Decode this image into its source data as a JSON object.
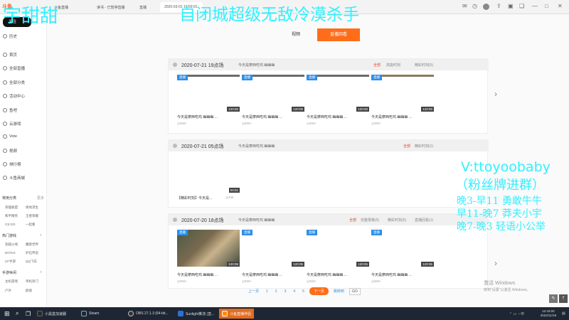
{
  "browser": {
    "logo": "斗鱼",
    "tabs": [
      "斗鱼直播",
      "读书 - 已暂停直播",
      "直播",
      "2020-03-01 19:59:01",
      "",
      "",
      ""
    ],
    "live_badge": "2 正在直播"
  },
  "overlay": {
    "name": "宇甜甜",
    "title": "自闭城超级无敌冷漠杀手",
    "contact": "V:ttoyoobaby",
    "fan": "（粉丝牌进群）",
    "schedule": [
      "晚3-早11 勇敢牛牛",
      "早11-晚7 莽夫小宇",
      "晚7-晚3  轻语小公举"
    ]
  },
  "sidebar": {
    "top": [
      {
        "icon": "heart-icon",
        "label": "关注"
      },
      {
        "icon": "history-icon",
        "label": "历史"
      }
    ],
    "nav": [
      {
        "icon": "home-icon",
        "label": "首页"
      },
      {
        "icon": "grid-icon",
        "label": "全部直播"
      },
      {
        "icon": "category-icon",
        "label": "全部分类"
      },
      {
        "icon": "activity-icon",
        "label": "活动中心"
      },
      {
        "icon": "video-icon",
        "label": "鱼吧"
      },
      {
        "icon": "game-icon",
        "label": "云游戏"
      },
      {
        "icon": "music-icon",
        "label": "Vote"
      },
      {
        "icon": "clip-icon",
        "label": "视频"
      },
      {
        "icon": "rank-icon",
        "label": "排行榜"
      },
      {
        "icon": "shop-icon",
        "label": "斗鱼商城"
      }
    ],
    "section1": {
      "title": "常用分类",
      "more": "更多"
    },
    "section1_items": [
      "英雄联盟",
      "绝地求生",
      "和平精英",
      "王者荣耀",
      "CS:GO",
      "一起看"
    ],
    "section2": {
      "title": "热门游戏",
      "more": "+"
    },
    "section2_items": [
      "穿越火线",
      "魔兽世界",
      "DOTA2",
      "炉石传说",
      "CF手游",
      "QQ飞车"
    ],
    "section3": {
      "title": "手游休闲",
      "more": "+"
    },
    "section3_items": [
      "主机游戏",
      "单机热门",
      "户外",
      "颜值"
    ]
  },
  "main": {
    "segments": [
      "视频",
      "直播回看"
    ],
    "pager": {
      "prev": "上一页",
      "pages": [
        "1",
        "2",
        "3",
        "4",
        "5"
      ],
      "current": "下一页",
      "jump": "跳转到",
      "go": "GO"
    },
    "cards": [
      {
        "date": "2020-07-21 19点场",
        "title": "今天是摩西吃鸡 幽幽幽",
        "filters": [
          "全部",
          "高能时刻",
          "精彩时刻(5)"
        ],
        "videos": [
          {
            "badge": "直播",
            "dur": "120:00",
            "title": "今天是摩西吃鸡 幽幽幽 ...",
            "meta": "◎999+"
          },
          {
            "badge": "直播",
            "dur": "120:00",
            "title": "今天是摩西吃鸡 幽幽幽 ...",
            "meta": "◎999+"
          },
          {
            "badge": "直播",
            "dur": "120:00",
            "title": "今天是摩西吃鸡 幽幽幽 ...",
            "meta": "◎999+"
          },
          {
            "badge": "直播",
            "dur": "120:00",
            "title": "今天是摩西吃鸡 幽幽幽 ...",
            "meta": "◎999+"
          }
        ]
      },
      {
        "date": "2020-07-21 05点场",
        "title": "今天是摩西吃鸡 幽幽幽",
        "filters": [
          "全部",
          "精彩时刻(1)"
        ],
        "videos": [
          {
            "badge": "",
            "dur": "04:01",
            "title": "【精彩时刻】今天是...",
            "meta": "◎496"
          }
        ]
      },
      {
        "date": "2020-07-20 18点场",
        "title": "今天是摩西吃鸡 幽幽幽",
        "filters": [
          "全部",
          "完整录像(5)",
          "精彩时刻(5)",
          "直播回看(1)"
        ],
        "videos": [
          {
            "badge": "直播",
            "dur": "120:05",
            "title": "今天是摩西吃鸡 幽幽幽 ...",
            "meta": "◎999+"
          },
          {
            "badge": "直播",
            "dur": "120:05",
            "title": "今天是摩西吃鸡 幽幽幽 ...",
            "meta": "◎999+"
          },
          {
            "badge": "直播",
            "dur": "120:05",
            "title": "今天是摩西吃鸡 幽幽幽 ...",
            "meta": "◎999+"
          },
          {
            "badge": "直播",
            "dur": "120:05",
            "title": "今天是摩西吃鸡 幽幽幽 ...",
            "meta": "◎999+"
          }
        ]
      }
    ]
  },
  "watermark": {
    "line1": "激活 Windows",
    "line2": "转到\"设置\"以激活 Windows。"
  },
  "taskbar": {
    "items": [
      {
        "label": "",
        "icon": "windows-icon",
        "color": "#ffffff"
      },
      {
        "label": "",
        "icon": "search-icon",
        "color": "#ffffff"
      },
      {
        "label": "",
        "icon": "taskview-icon",
        "color": "#ffffff"
      },
      {
        "label": "小黑盒加速器",
        "icon": "box-icon",
        "color": "#2a2a2a"
      },
      {
        "label": "Steam",
        "icon": "steam-icon",
        "color": "#1b2838"
      },
      {
        "label": "OBS 27.1.3 (64-bit...",
        "icon": "obs-icon",
        "color": "#333333"
      },
      {
        "label": "Sunlight推流 (直...",
        "icon": "stream-icon",
        "color": "#2d6fd4"
      },
      {
        "label": "斗鱼直播伴侣",
        "icon": "douyu-icon",
        "color": "#ff8a00"
      }
    ],
    "time": "12:43:00",
    "date": "2022/11/19"
  }
}
